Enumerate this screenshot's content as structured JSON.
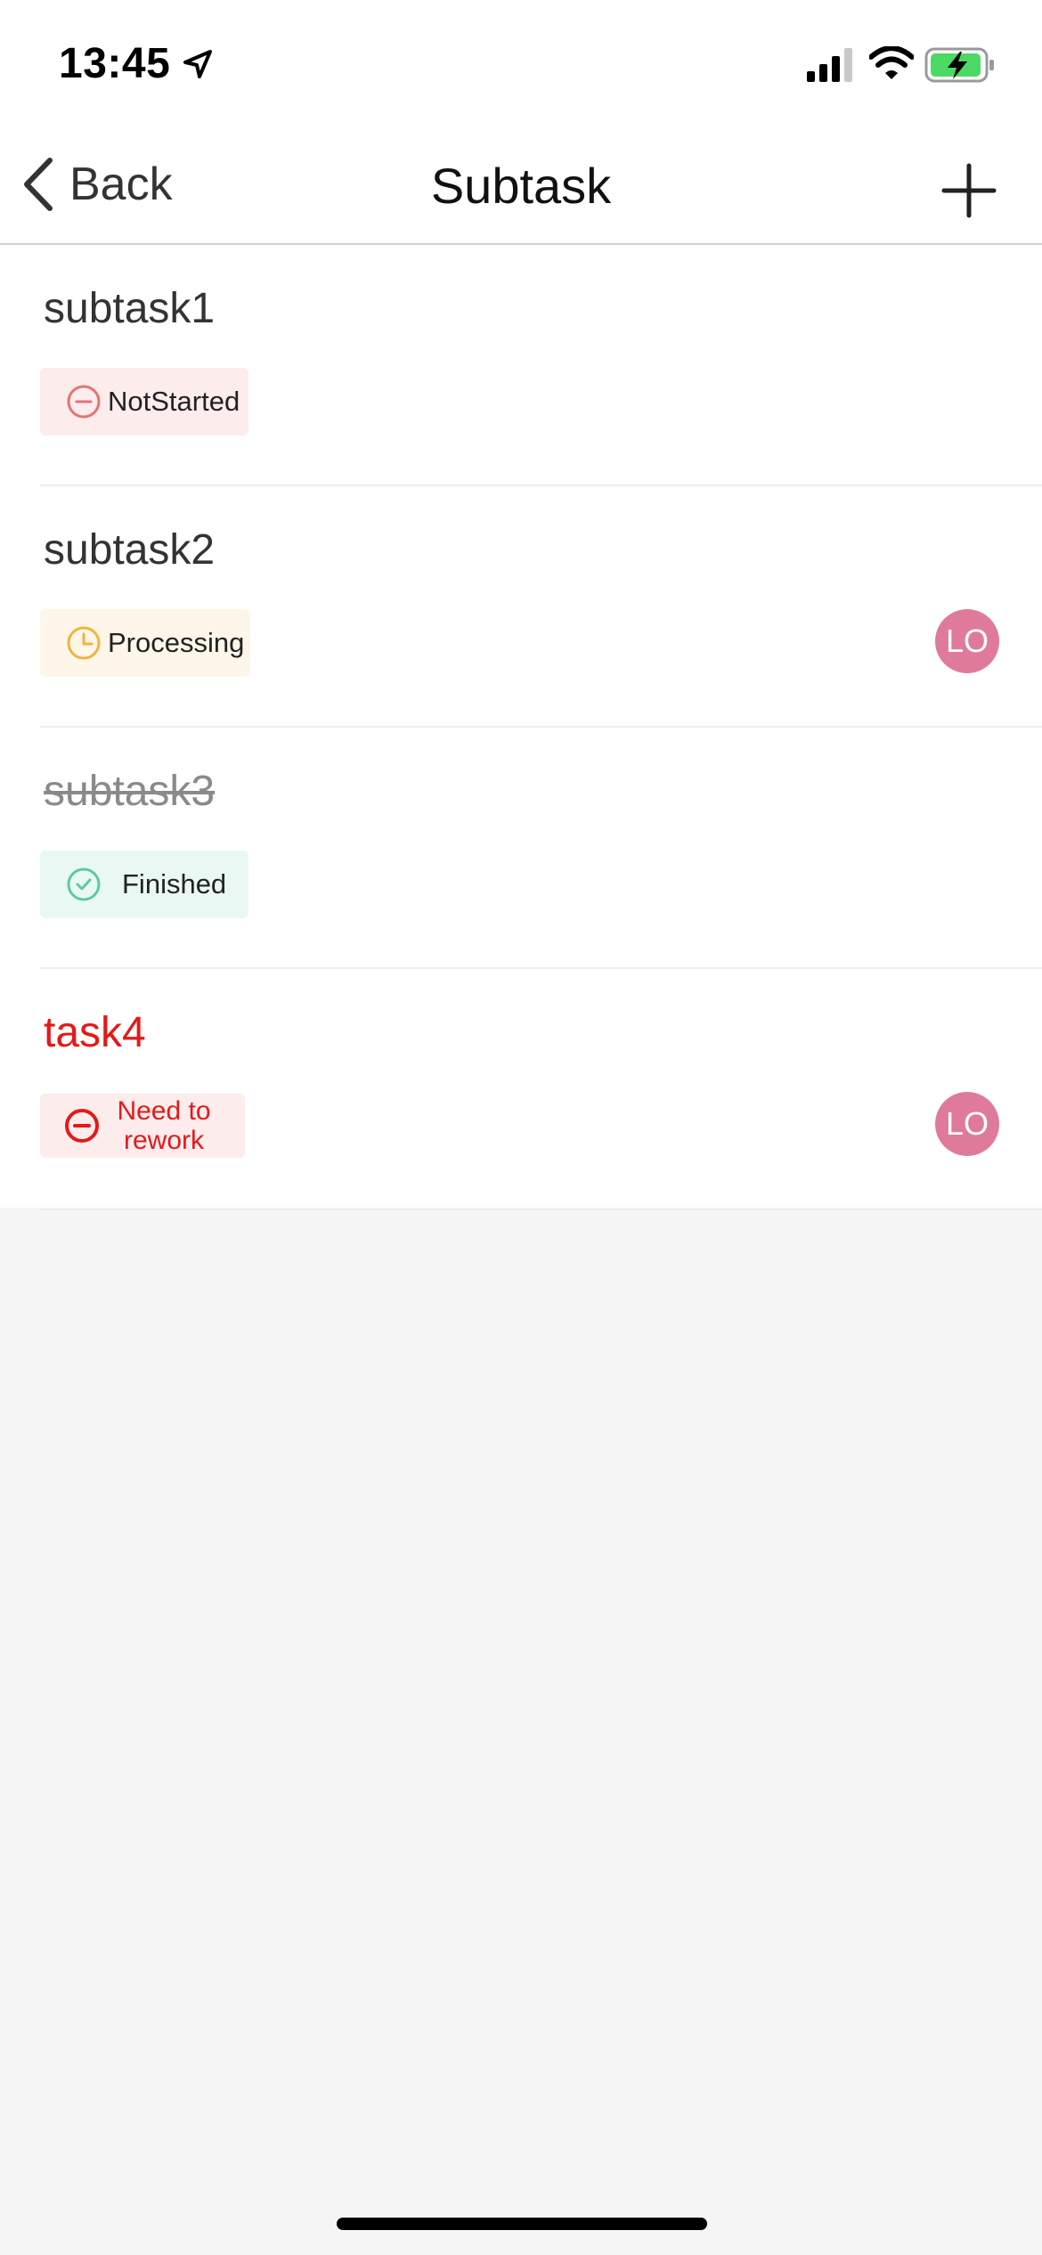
{
  "status_bar": {
    "time": "13:45",
    "icons": [
      "location-arrow-icon",
      "cellular-signal-icon",
      "wifi-icon",
      "battery-charging-icon"
    ]
  },
  "nav": {
    "back_label": "Back",
    "title": "Subtask",
    "add_icon": "plus-icon"
  },
  "subtasks": [
    {
      "title": "subtask1",
      "status": "NotStarted",
      "status_icon": "minus-circle-icon",
      "assignee": ""
    },
    {
      "title": "subtask2",
      "status": "Processing",
      "status_icon": "clock-icon",
      "assignee": "LO"
    },
    {
      "title": "subtask3",
      "status": "Finished",
      "status_icon": "check-circle-icon",
      "assignee": ""
    },
    {
      "title": "task4",
      "status": "Need to rework",
      "status_icon": "minus-circle-icon",
      "assignee": "LO"
    }
  ],
  "colors": {
    "not_started": "#e57373",
    "processing": "#f0b43c",
    "finished": "#5cc9a7",
    "rework": "#e31a1a",
    "avatar": "#e07a9b"
  }
}
